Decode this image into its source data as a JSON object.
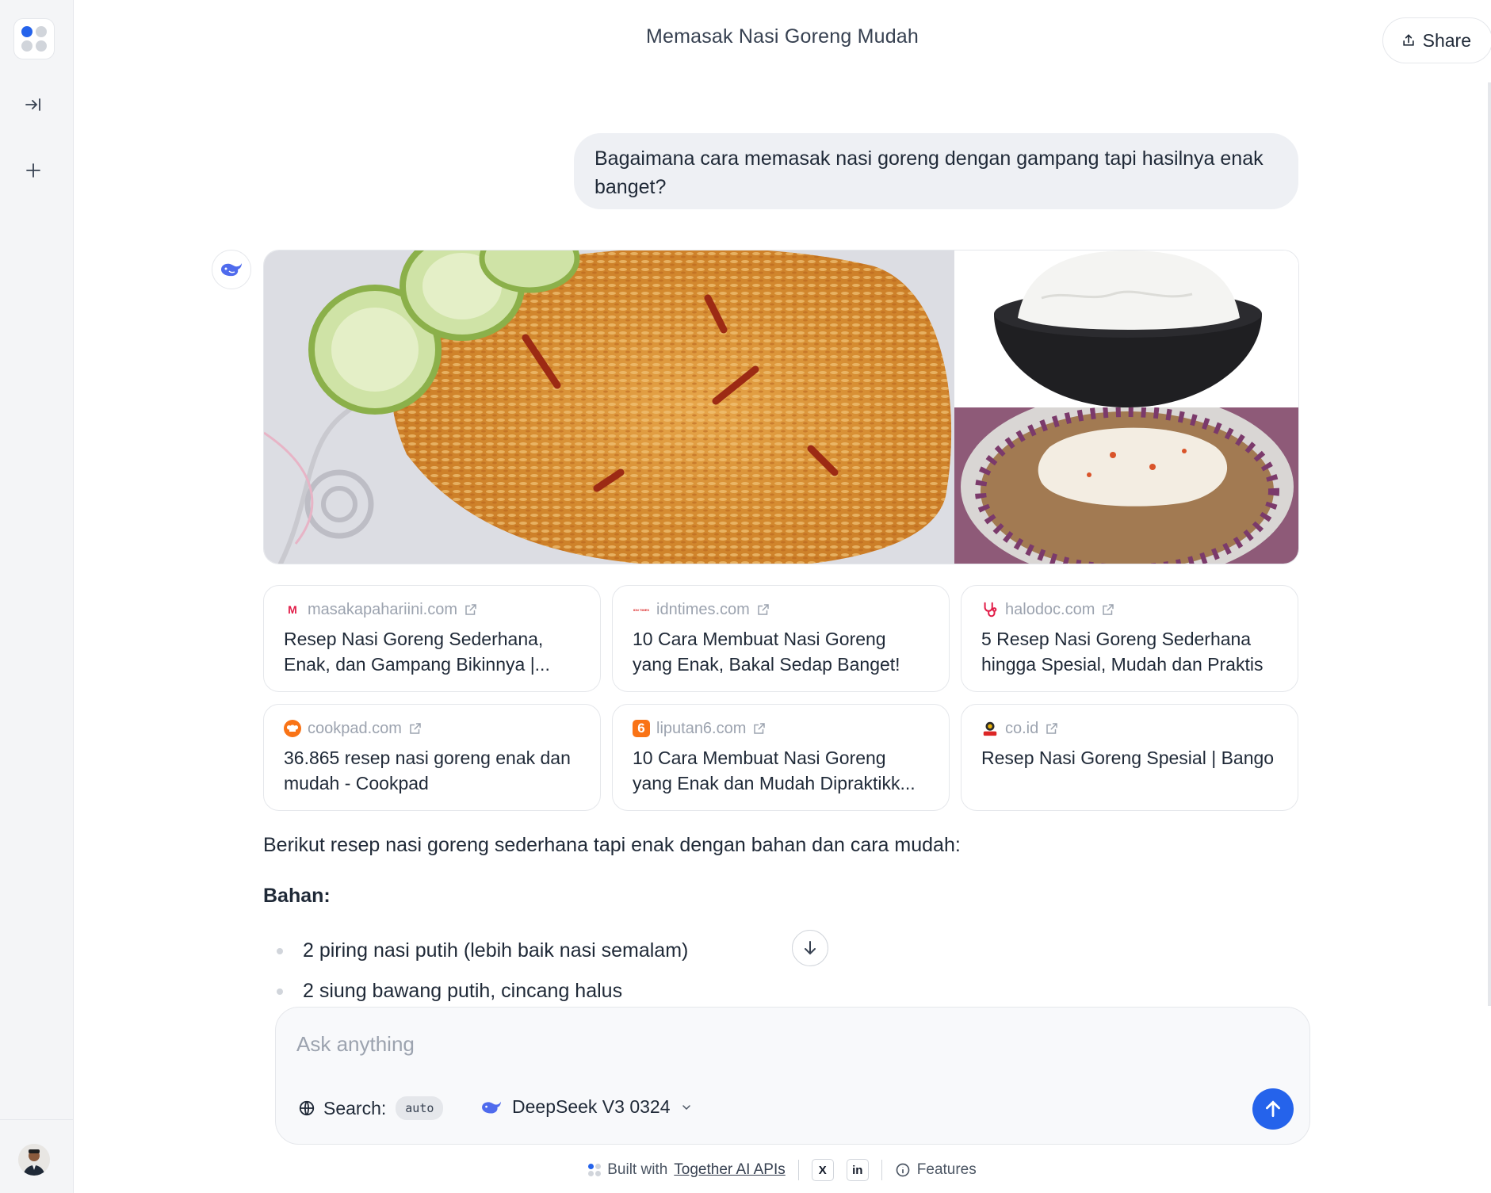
{
  "header": {
    "title": "Memasak Nasi Goreng Mudah",
    "share_label": "Share"
  },
  "sidebar": {
    "icons": [
      "app-logo",
      "collapse-sidebar-icon",
      "plus-icon",
      "avatar"
    ]
  },
  "conversation": {
    "user_message": "Bagaimana cara memasak nasi goreng dengan gampang tapi hasilnya enak banget?",
    "images": [
      "nasi goreng dengan timun",
      "semangkuk nasi putih",
      "nasi goreng dengan telur dan kol ungu"
    ],
    "sources": [
      {
        "domain": "masakapahariini.com",
        "title": "Resep Nasi Goreng Sederhana, Enak, dan Gampang Bikinnya |...",
        "favicon": "M",
        "favicon_color": "#e11d48"
      },
      {
        "domain": "idntimes.com",
        "title": "10 Cara Membuat Nasi Goreng yang Enak, Bakal Sedap Banget!",
        "favicon": "IDN TIMES",
        "favicon_color": "#dc2626"
      },
      {
        "domain": "halodoc.com",
        "title": "5 Resep Nasi Goreng Sederhana hingga Spesial, Mudah dan Praktis",
        "favicon": "stethoscope-icon",
        "favicon_color": "#e11d48"
      },
      {
        "domain": "cookpad.com",
        "title": "36.865 resep nasi goreng enak dan mudah - Cookpad",
        "favicon": "chef-hat-icon",
        "favicon_color": "#f97316"
      },
      {
        "domain": "liputan6.com",
        "title": "10 Cara Membuat Nasi Goreng yang Enak dan Mudah Dipraktikk...",
        "favicon": "6",
        "favicon_color": "#f97316"
      },
      {
        "domain": "co.id",
        "title": "Resep Nasi Goreng Spesial | Bango",
        "favicon": "bango-icon",
        "favicon_color": "#ca8a04"
      }
    ],
    "answer": {
      "intro": "Berikut resep nasi goreng sederhana tapi enak dengan bahan dan cara mudah:",
      "heading": "Bahan:",
      "bullets": [
        "2 piring nasi putih (lebih baik nasi semalam)",
        "2 siung bawang putih, cincang halus"
      ]
    }
  },
  "composer": {
    "placeholder": "Ask anything",
    "search_label": "Search:",
    "search_mode": "auto",
    "model": "DeepSeek V3 0324"
  },
  "footer": {
    "built_with": "Built with",
    "built_with_link": "Together AI APIs",
    "x_label": "X",
    "linkedin_label": "in",
    "features": "Features"
  },
  "colors": {
    "accent": "#2563eb",
    "bubble": "#eef0f4",
    "sidebar": "#f4f5f7"
  }
}
